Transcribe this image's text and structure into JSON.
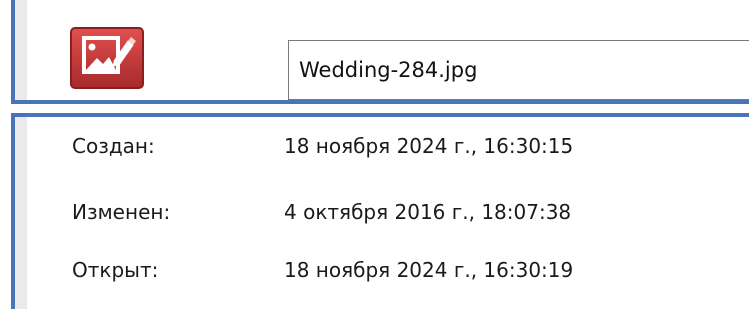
{
  "header": {
    "file_icon": "picture-file-icon",
    "filename": "Wedding-284.jpg"
  },
  "properties": [
    {
      "label": "Создан:",
      "value": "18 ноября 2024 г., 16:30:15"
    },
    {
      "label": "Изменен:",
      "value": "4 октября 2016 г., 18:07:38"
    },
    {
      "label": "Открыт:",
      "value": "18 ноября 2024 г., 16:30:19"
    }
  ],
  "colors": {
    "accent_border": "#4a74b8",
    "icon_red": "#c8393a"
  }
}
